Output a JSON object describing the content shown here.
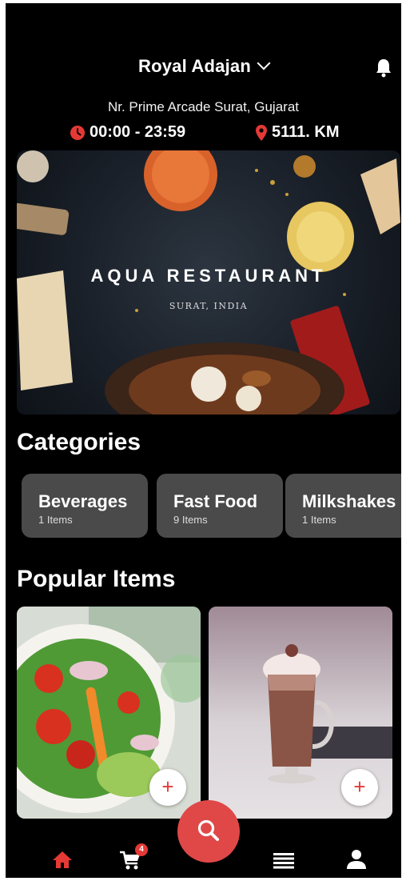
{
  "header": {
    "location_name": "Royal Adajan",
    "address": "Nr. Prime Arcade Surat, Gujarat",
    "hours": "00:00 - 23:59",
    "distance": "5111. KM"
  },
  "banner": {
    "restaurant_name": "AQUA RESTAURANT",
    "subtitle": "SURAT, INDIA"
  },
  "categories": {
    "title": "Categories",
    "items": [
      {
        "name": "Beverages",
        "count": "1 Items"
      },
      {
        "name": "Fast Food",
        "count": "9 Items"
      },
      {
        "name": "Milkshakes",
        "count": "1 Items"
      }
    ]
  },
  "popular": {
    "title": "Popular Items",
    "add_label": "+"
  },
  "nav": {
    "cart_count": "4",
    "active": "home"
  },
  "colors": {
    "accent": "#e53935",
    "background": "#000000",
    "card": "#4a4a4a"
  }
}
